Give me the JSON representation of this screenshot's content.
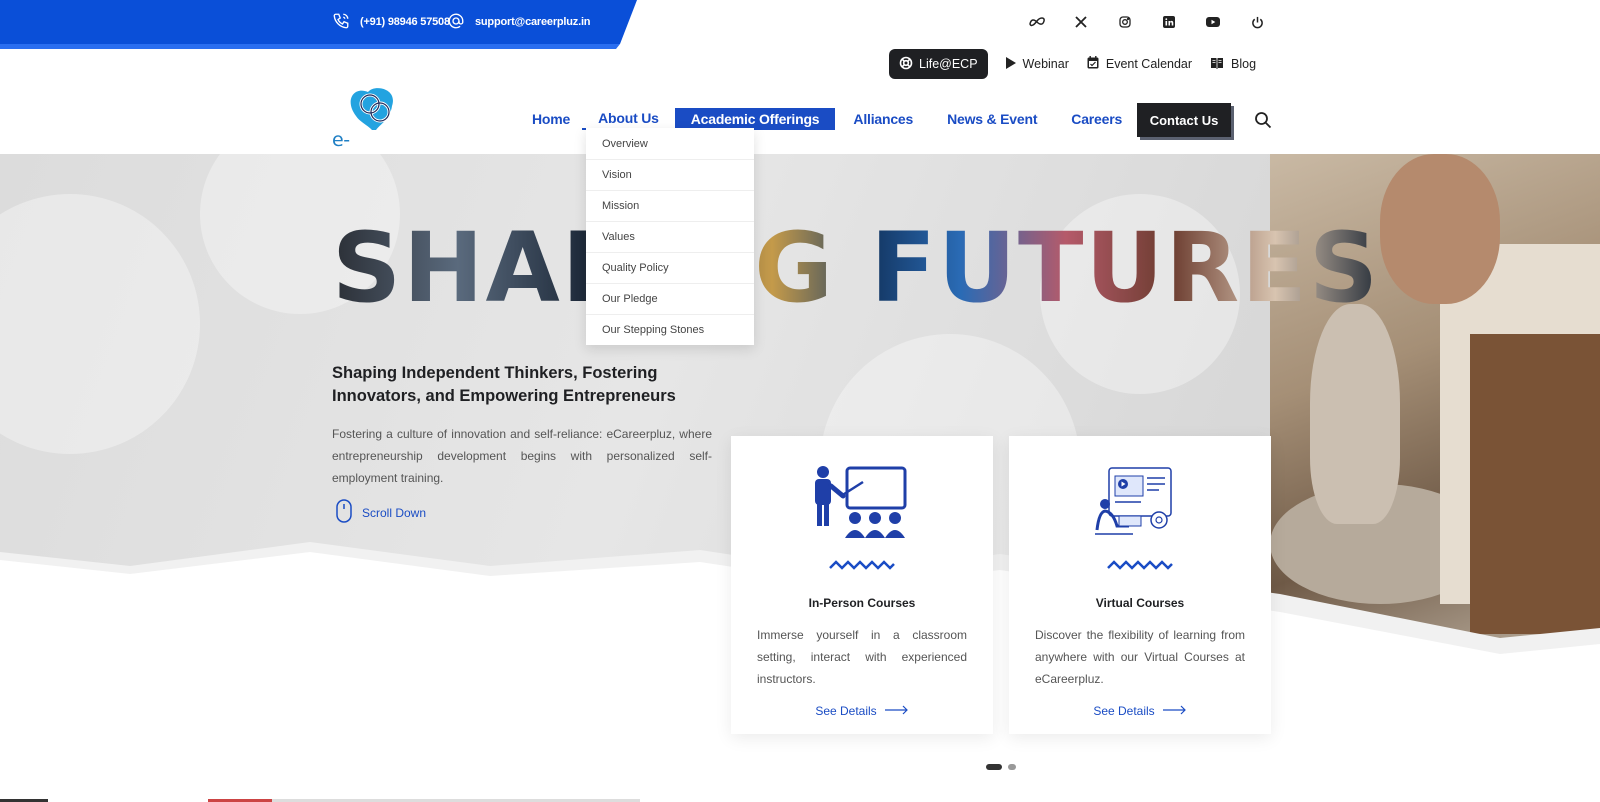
{
  "topbar": {
    "phone": "(+91) 98946 57508",
    "email": "support@careerpluz.in",
    "brand_color": "#0a4fd8",
    "social_icons": [
      "meta-icon",
      "x-icon",
      "instagram-icon",
      "linkedin-icon",
      "youtube-icon",
      "power-icon"
    ]
  },
  "secondary_nav": {
    "life": "Life@ECP",
    "webinar": "Webinar",
    "event_calendar": "Event Calendar",
    "blog": "Blog"
  },
  "logo": {
    "mark": "cp",
    "text": "e-careerpluz"
  },
  "main_nav": {
    "home": "Home",
    "about": "About Us",
    "academic": "Academic Offerings",
    "alliances": "Alliances",
    "news": "News & Event",
    "careers": "Careers",
    "contact": "Contact Us",
    "accent": "#1a4cc4"
  },
  "dropdown": {
    "items": [
      "Overview",
      "Vision",
      "Mission",
      "Values",
      "Quality Policy",
      "Our Pledge",
      "Our Stepping Stones"
    ]
  },
  "hero": {
    "big_title": "SHAPING FUTURES",
    "heading": "Shaping Independent Thinkers, Fostering Innovators, and Empowering Entrepreneurs",
    "paragraph": "Fostering a culture of innovation and self-reliance: eCareerpluz, where entrepreneurship development begins with personalized self-employment training.",
    "scroll": "Scroll Down"
  },
  "cards": [
    {
      "title": "In-Person Courses",
      "text": "Immerse yourself in a classroom setting, interact with experienced instructors.",
      "link": "See Details"
    },
    {
      "title": "Virtual Courses",
      "text": "Discover the flexibility of learning from anywhere with our Virtual Courses at eCareerpluz.",
      "link": "See Details"
    }
  ],
  "carousel": {
    "total": 2,
    "active": 1
  }
}
